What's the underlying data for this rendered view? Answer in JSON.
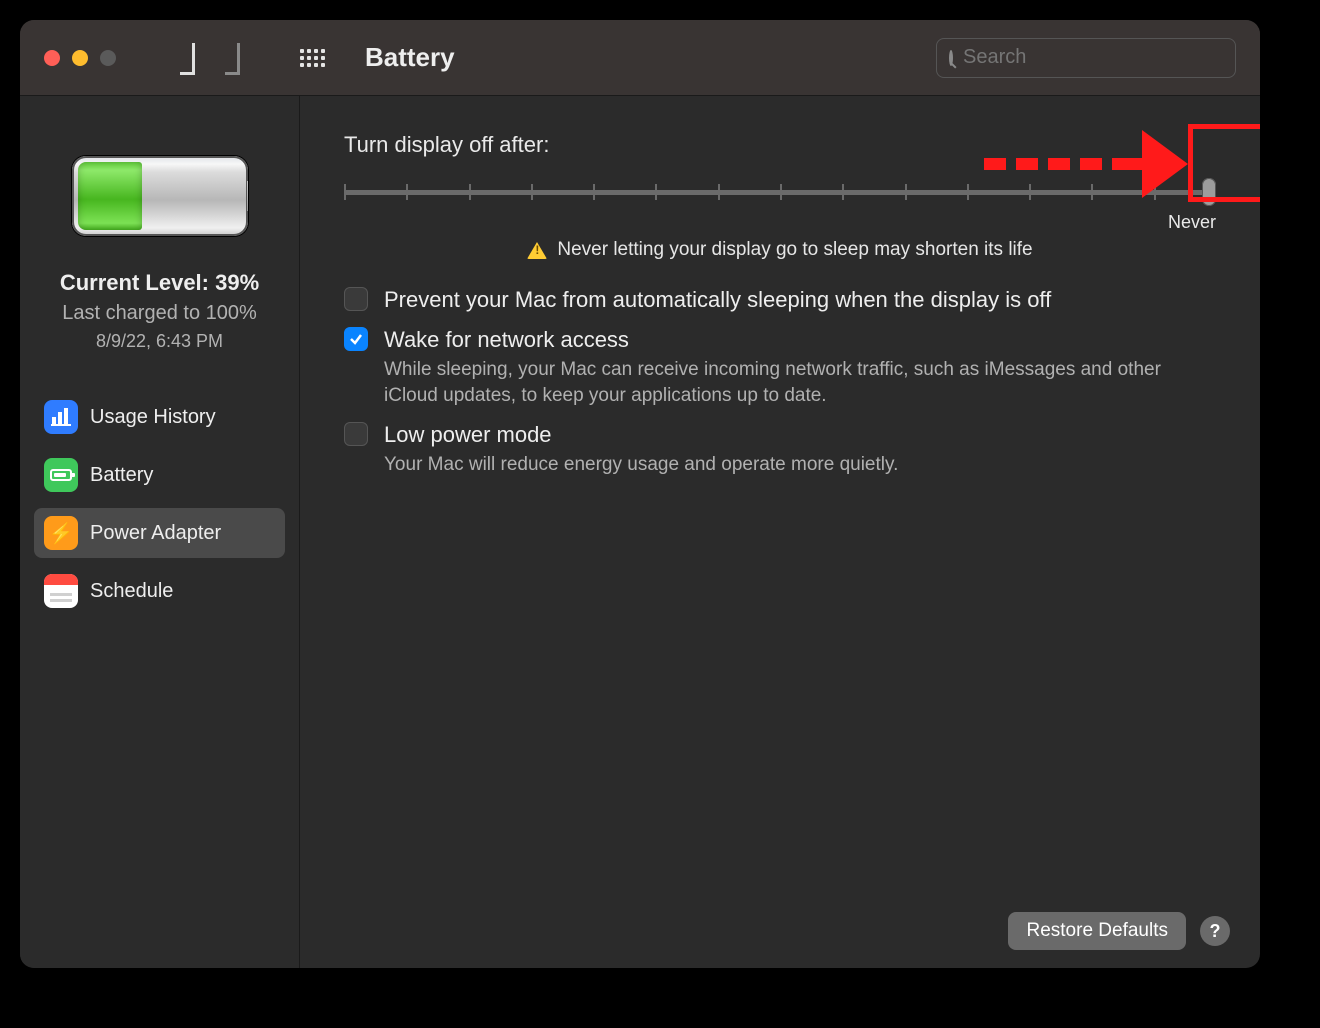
{
  "window": {
    "title": "Battery"
  },
  "search": {
    "placeholder": "Search"
  },
  "sidebar": {
    "current_level_label": "Current Level: 39%",
    "last_charged_label": "Last charged to 100%",
    "last_charged_date": "8/9/22, 6:43 PM",
    "items": [
      {
        "id": "usage-history",
        "label": "Usage History",
        "selected": false
      },
      {
        "id": "battery",
        "label": "Battery",
        "selected": false
      },
      {
        "id": "power-adapter",
        "label": "Power Adapter",
        "selected": true
      },
      {
        "id": "schedule",
        "label": "Schedule",
        "selected": false
      }
    ]
  },
  "main": {
    "slider_title": "Turn display off after:",
    "slider_right_label": "Never",
    "warning_text": "Never letting your display go to sleep may shorten its life",
    "options": {
      "prevent_sleep": {
        "label": "Prevent your Mac from automatically sleeping when the display is off",
        "checked": false
      },
      "wake_network": {
        "label": "Wake for network access",
        "checked": true,
        "desc": "While sleeping, your Mac can receive incoming network traffic, such as iMessages and other iCloud updates, to keep your applications up to date."
      },
      "low_power": {
        "label": "Low power mode",
        "checked": false,
        "desc": "Your Mac will reduce energy usage and operate more quietly."
      }
    },
    "restore_button": "Restore Defaults",
    "help_button": "?"
  },
  "annotation": {
    "type": "arrow-to-box",
    "target": "slider-thumb",
    "color": "#ff1a1a"
  }
}
